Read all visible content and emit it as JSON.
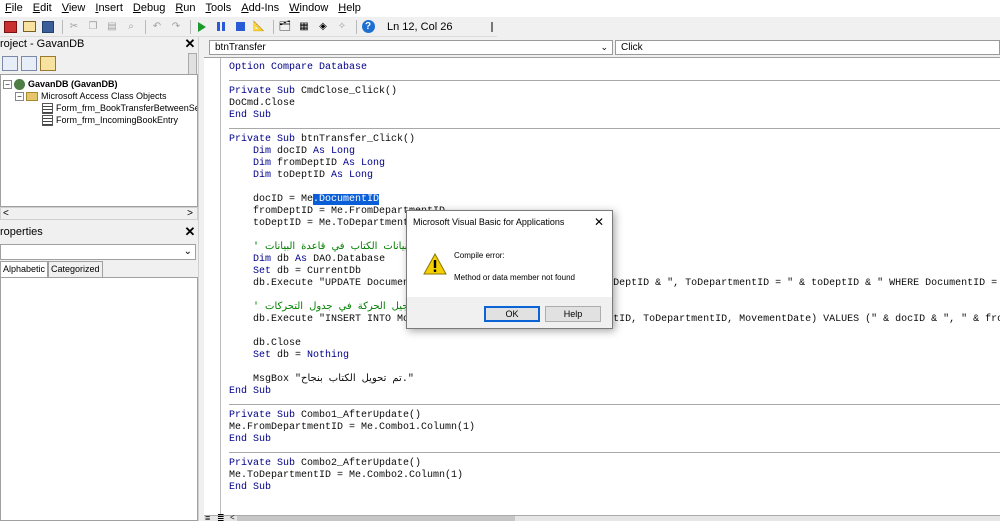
{
  "menu": [
    "File",
    "Edit",
    "View",
    "Insert",
    "Debug",
    "Run",
    "Tools",
    "Add-Ins",
    "Window",
    "Help"
  ],
  "menu_underline": [
    "F",
    "E",
    "V",
    "I",
    "D",
    "R",
    "T",
    "A",
    "W",
    "H"
  ],
  "toolbar": {
    "status": "Ln 12, Col 26",
    "icons": [
      "access-icon",
      "insert-form-icon",
      "save-icon",
      "cut-icon",
      "copy-icon",
      "paste-icon",
      "find-icon",
      "undo-icon",
      "redo-icon",
      "run-icon",
      "break-icon",
      "reset-icon",
      "design-mode-icon",
      "project-explorer-icon",
      "properties-icon",
      "object-browser-icon",
      "toolbox-icon",
      "help-icon"
    ]
  },
  "project": {
    "title": "roject - GavanDB",
    "tree": [
      {
        "label": "GavanDB (GavanDB)",
        "level": 0,
        "type": "db",
        "bold": true
      },
      {
        "label": "Microsoft Access Class Objects",
        "level": 1,
        "type": "folder",
        "bold": false
      },
      {
        "label": "Form_frm_BookTransferBetweenSectio",
        "level": 2,
        "type": "module",
        "bold": false
      },
      {
        "label": "Form_frm_IncomingBookEntry",
        "level": 2,
        "type": "module",
        "bold": false
      }
    ]
  },
  "properties": {
    "title": "roperties",
    "tabs": [
      "Alphabetic",
      "Categorized"
    ],
    "active_tab": "Alphabetic"
  },
  "code_window": {
    "object_combo": "btnTransfer",
    "proc_combo": "Click",
    "cursor": {
      "line": 12,
      "col": 26
    }
  },
  "code": [
    [
      [
        "kw",
        "Option Compare Database"
      ]
    ],
    [],
    [
      [
        "kw",
        "Private Sub "
      ],
      [
        "",
        "CmdClose_Click()"
      ]
    ],
    [
      [
        "",
        "DoCmd.Close"
      ]
    ],
    [
      [
        "kw",
        "End Sub"
      ]
    ],
    [],
    [
      [
        "kw",
        "Private Sub "
      ],
      [
        "",
        "btnTransfer_Click()"
      ]
    ],
    [
      [
        "",
        "    "
      ],
      [
        "kw",
        "Dim "
      ],
      [
        "",
        "docID "
      ],
      [
        "kw",
        "As Long"
      ]
    ],
    [
      [
        "",
        "    "
      ],
      [
        "kw",
        "Dim "
      ],
      [
        "",
        "fromDeptID "
      ],
      [
        "kw",
        "As Long"
      ]
    ],
    [
      [
        "",
        "    "
      ],
      [
        "kw",
        "Dim "
      ],
      [
        "",
        "toDeptID "
      ],
      [
        "kw",
        "As Long"
      ]
    ],
    [],
    [
      [
        "",
        "    docID = Me"
      ],
      [
        "hl",
        ".DocumentID"
      ]
    ],
    [
      [
        "",
        "    fromDeptID = Me.FromDepartmentID"
      ]
    ],
    [
      [
        "",
        "    toDeptID = Me.ToDepartmentID"
      ]
    ],
    [],
    [
      [
        "",
        "    "
      ],
      [
        "cm",
        "' تحديث بيانات الكتاب في قاعدة البيانات"
      ]
    ],
    [
      [
        "",
        "    "
      ],
      [
        "kw",
        "Dim "
      ],
      [
        "",
        "db "
      ],
      [
        "kw",
        "As "
      ],
      [
        "",
        "DAO.Database"
      ]
    ],
    [
      [
        "",
        "    "
      ],
      [
        "kw",
        "Set "
      ],
      [
        "",
        "db = CurrentDb"
      ]
    ],
    [
      [
        "",
        "    db.Execute \"UPDATE Documents SET FromDepartmentID = \" & fromDeptID & \", ToDepartmentID = \" & toDeptID & \" WHERE DocumentID = \" & docID"
      ]
    ],
    [],
    [
      [
        "",
        "    "
      ],
      [
        "cm",
        "' تسجيل الحركة في جدول التحركات"
      ]
    ],
    [
      [
        "",
        "    db.Execute \"INSERT INTO Movements (DocumentID, FromDepartmentID, ToDepartmentID, MovementDate) VALUES (\" & docID & \", \" & fromDeptID"
      ]
    ],
    [],
    [
      [
        "",
        "    db.Close"
      ]
    ],
    [
      [
        "",
        "    "
      ],
      [
        "kw",
        "Set "
      ],
      [
        "",
        "db = "
      ],
      [
        "kw",
        "Nothing"
      ]
    ],
    [],
    [
      [
        "",
        "    MsgBox \"تم تحويل الكتاب بنجاح.\""
      ]
    ],
    [
      [
        "kw",
        "End Sub"
      ]
    ],
    [],
    [
      [
        "kw",
        "Private Sub "
      ],
      [
        "",
        "Combo1_AfterUpdate()"
      ]
    ],
    [
      [
        "",
        "Me.FromDepartmentID = Me.Combo1.Column(1)"
      ]
    ],
    [
      [
        "kw",
        "End Sub"
      ]
    ],
    [],
    [
      [
        "kw",
        "Private Sub "
      ],
      [
        "",
        "Combo2_AfterUpdate()"
      ]
    ],
    [
      [
        "",
        "Me.ToDepartmentID = Me.Combo2.Column(1)"
      ]
    ],
    [
      [
        "kw",
        "End Sub"
      ]
    ]
  ],
  "dialog": {
    "title": "Microsoft Visual Basic for Applications",
    "close": "✕",
    "heading": "Compile error:",
    "message": "Method or data member not found",
    "ok_label": "OK",
    "help_label": "Help"
  }
}
